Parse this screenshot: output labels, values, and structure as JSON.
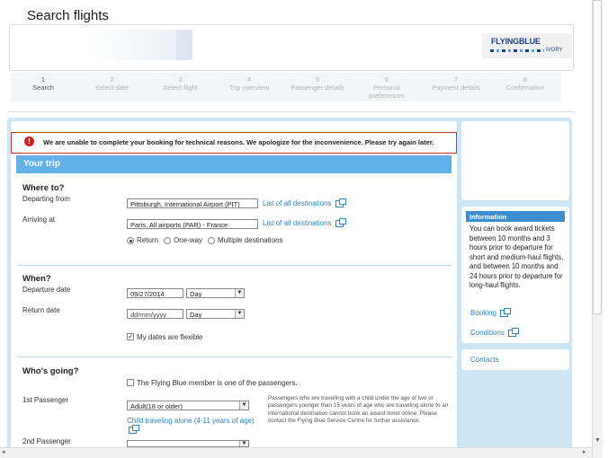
{
  "page_title": "Search flights",
  "logo": {
    "brand": "FLYINGBLUE",
    "tier": "IVORY"
  },
  "steps": [
    {
      "num": "1",
      "label": "Search"
    },
    {
      "num": "2",
      "label": "Select date"
    },
    {
      "num": "3",
      "label": "Select flight"
    },
    {
      "num": "4",
      "label": "Trip overview"
    },
    {
      "num": "5",
      "label": "Passenger details"
    },
    {
      "num": "6",
      "label": "Personal preferences"
    },
    {
      "num": "7",
      "label": "Payment details"
    },
    {
      "num": "8",
      "label": "Confirmation"
    }
  ],
  "error": {
    "message": "We are unable to complete your booking for technical reasons. We apologize for the inconvenience. Please try again later."
  },
  "trip": {
    "title": "Your trip",
    "where_heading": "Where to?",
    "departing_label": "Departing from",
    "departing_value": "Pittsburgh, International Airport (PIT)",
    "arriving_label": "Arriving at",
    "arriving_value": "Paris, All airports (PAR) - France",
    "all_destinations": "List of all destinations",
    "radio_return": "Return",
    "radio_oneway": "One-way",
    "radio_multi": "Multiple destinations",
    "when_heading": "When?",
    "departure_date_label": "Departure date",
    "departure_date_value": "09/27/2014",
    "day_option": "Day",
    "return_date_label": "Return date",
    "return_date_placeholder": "dd/mm/yyyy",
    "flexible_label": "My dates are flexible",
    "who_heading": "Who's going?",
    "member_label": "The Flying Blue member is one of the passengers.",
    "passenger1_label": "1st Passenger",
    "passenger1_value": "Adult(18 or older)",
    "child_alone_link": "Child traveling alone (4-11 years of age)",
    "passenger2_label": "2nd Passenger",
    "passenger_note": "Passengers who are travelling with a child under the age of two or passengers younger than 15 years of age who are travelling alone to an international destination cannot book an award ticket online. Please contact the Flying Blue Service Centre for further assistance."
  },
  "sidebar": {
    "info_heading": "Information",
    "info_text": "You can book award tickets between 10 months and 3 hours prior to departure for short and medium-haul flights, and between 10 months and 24 hours prior to departure for long-haul flights.",
    "booking_link": "Booking",
    "conditions_link": "Conditions",
    "contacts_link": "Contacts"
  },
  "scroll": {
    "up_arrow": "▲",
    "down_arrow": "▼",
    "left_arrow": "◂",
    "right_arrow": "▸"
  },
  "colors": {
    "accent": "#62b0e8",
    "link": "#2b87c8",
    "panel_bg": "#cde6f4",
    "error_border": "#c0392b"
  }
}
